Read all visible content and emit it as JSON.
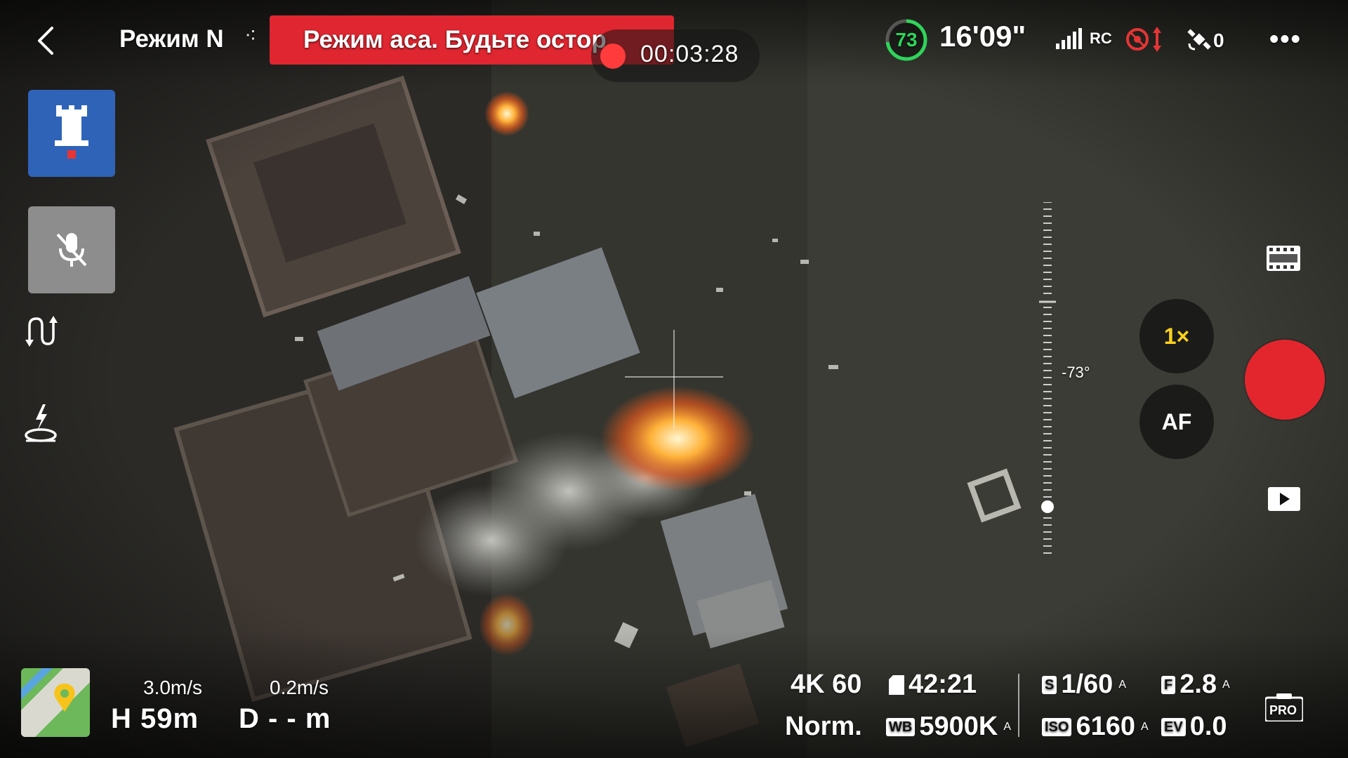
{
  "header": {
    "mode_label": "Режим N",
    "warning_text": "Режим аса. Будьте остор",
    "recording_time": "00:03:28"
  },
  "status": {
    "battery_percent": "73",
    "flight_time_remaining": "16'09\"",
    "rc_label": "RC",
    "satellite_count": "0"
  },
  "gimbal": {
    "pitch_label": "-73°"
  },
  "camera_controls": {
    "zoom_label": "1×",
    "focus_mode_label": "AF"
  },
  "telemetry": {
    "horizontal_speed": "3.0m/s",
    "vertical_speed": "0.2m/s",
    "height": "H 59m",
    "distance": "D - - m"
  },
  "camera_settings": {
    "resolution_fps": "4K 60",
    "record_remaining": "42:21",
    "color_profile": "Norm.",
    "white_balance_badge": "WB",
    "white_balance": "5900K",
    "shutter_badge": "S",
    "shutter_speed": "1/60",
    "iso_badge": "ISO",
    "iso": "6160",
    "aperture_badge": "F",
    "aperture": "2.8",
    "ev_badge": "EV",
    "exposure_value": "0.0",
    "auto_marker": "A",
    "pro_label": "PRO"
  },
  "colors": {
    "warning_banner": "#e02630",
    "record_button": "#e3262e",
    "battery_ring": "#2fd45a",
    "zoom_text": "#ffd21e",
    "map_lock_tile": "#2f63b8"
  }
}
